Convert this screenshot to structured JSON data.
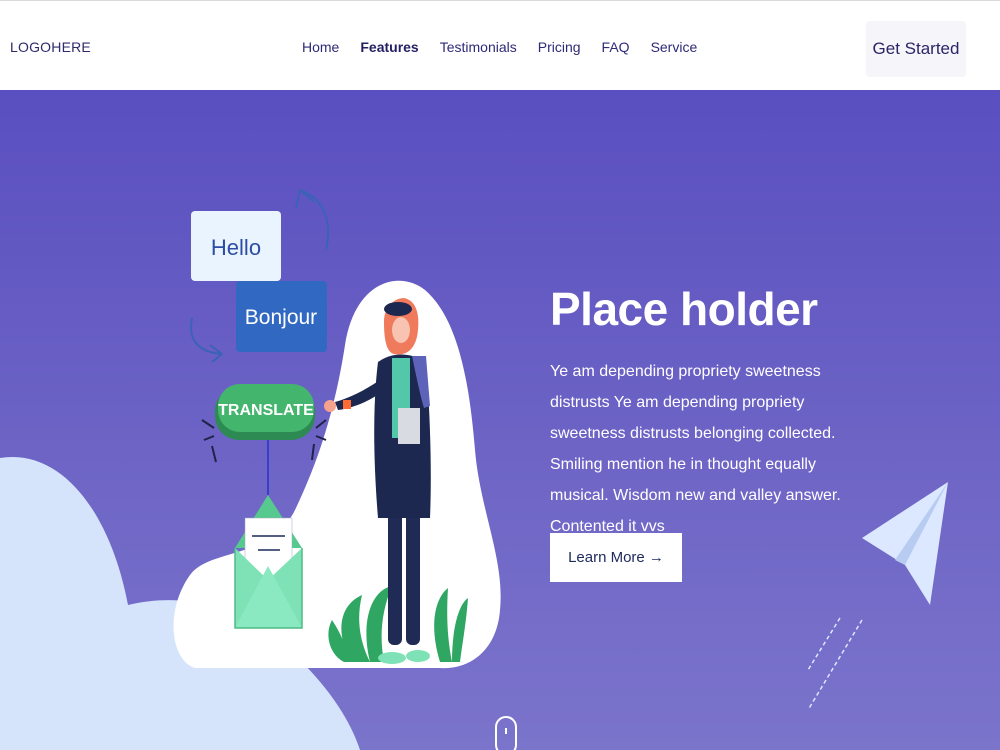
{
  "nav": {
    "logo": "LOGOHERE",
    "items": [
      {
        "label": "Home"
      },
      {
        "label": "Features"
      },
      {
        "label": "Testimonials"
      },
      {
        "label": "Pricing"
      },
      {
        "label": "FAQ"
      },
      {
        "label": "Service"
      }
    ],
    "cta_label": "Get Started"
  },
  "hero": {
    "title": "Place holder",
    "body": "Ye am depending propriety sweetness distrusts Ye am depending propriety sweetness distrusts belonging collected. Smiling mention he in thought equally musical. Wisdom new and valley answer. Contented it vvs",
    "button_label": "Learn More →"
  },
  "illustration": {
    "bubble_hello": "Hello",
    "bubble_bonjour": "Bonjour",
    "translate_label": "TRANSLATE"
  },
  "colors": {
    "hero_top": "#5a4fc0",
    "hero_bottom": "#7b74cb",
    "accent_green": "#3ea96a",
    "bubble_blue": "#3068c2",
    "cloud": "#d6e4fb"
  }
}
